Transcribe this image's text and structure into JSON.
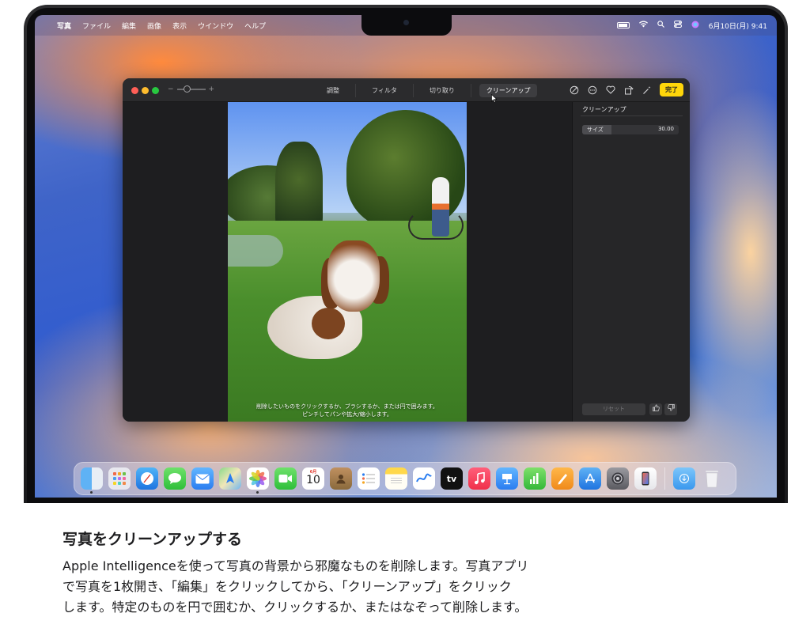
{
  "menubar": {
    "apple": "",
    "app_name": "写真",
    "menus": [
      "ファイル",
      "編集",
      "画像",
      "表示",
      "ウインドウ",
      "ヘルプ"
    ],
    "datetime": "6月10日(月)  9:41"
  },
  "window": {
    "zoom_minus": "−",
    "zoom_plus": "+",
    "tabs": [
      "調整",
      "フィルタ",
      "切り取り"
    ],
    "active_tab": "クリーンアップ",
    "done_label": "完了",
    "photo_hint_line1": "削除したいものをクリックするか、ブラシするか、または円で囲みます。",
    "photo_hint_line2": "ピンチしてパンや拡大/縮小します。",
    "sidebar": {
      "title": "クリーンアップ",
      "size_label": "サイズ",
      "size_value": "30.00",
      "size_fraction": 0.3,
      "reset_label": "リセット"
    }
  },
  "dock": {
    "calendar_month": "6月",
    "calendar_day": "10",
    "tv_label": "tv"
  },
  "caption": {
    "title": "写真をクリーンアップする",
    "line1": "Apple Intelligenceを使って写真の背景から邪魔なものを削除します。写真アプリ",
    "line2": "で写真を1枚開き、「編集」をクリックしてから、「クリーンアップ」をクリック",
    "line3": "します。特定のものを円で囲むか、クリックするか、またはなぞって削除します。"
  },
  "colors": {
    "done_button": "#ffd60a",
    "traffic_red": "#ff5f57",
    "traffic_yellow": "#febc2e",
    "traffic_green": "#28c840"
  }
}
